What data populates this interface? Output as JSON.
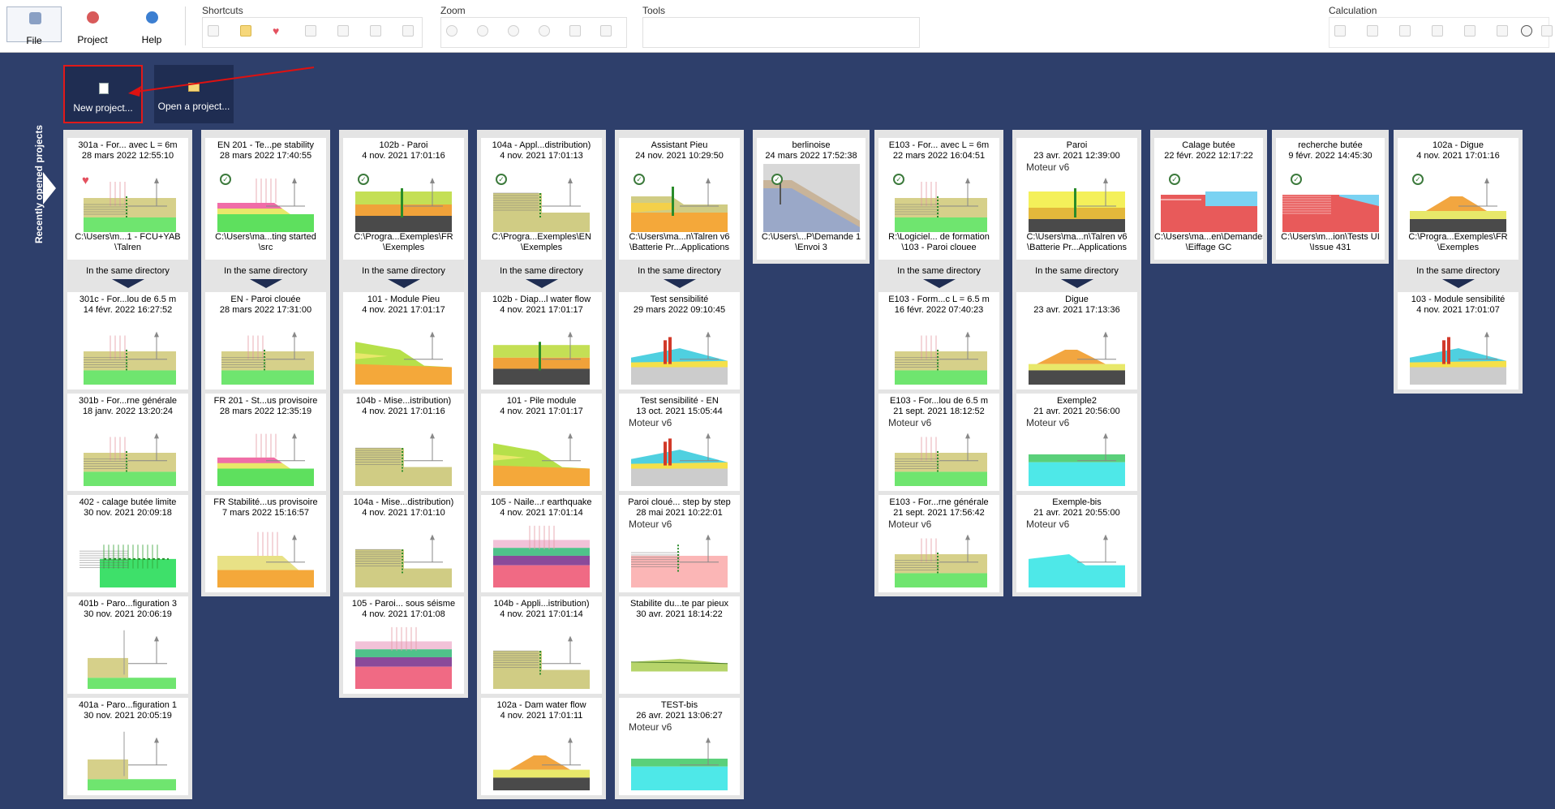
{
  "ribbon": {
    "file_label": "File",
    "project_label": "Project",
    "help_label": "Help",
    "groups": {
      "shortcuts": "Shortcuts",
      "zoom": "Zoom",
      "tools": "Tools",
      "calculation": "Calculation"
    }
  },
  "actions": {
    "new_project": "New project...",
    "open_project": "Open a project..."
  },
  "side_tab_label": "Recently opened projects",
  "same_dir_label": "In the same directory",
  "engine_tag": "Moteur v6",
  "columns": [
    {
      "top": {
        "title": "301a - For... avec L = 6m",
        "date": "28 mars 2022 12:55:10",
        "path1": "C:\\Users\\m...1 - FCU+YAB",
        "path2": "\\Talren",
        "badge": "heart",
        "scene": "nails-green"
      },
      "items": [
        {
          "title": "301c - For...lou de 6.5 m",
          "date": "14 févr. 2022 16:27:52",
          "scene": "nails-green"
        },
        {
          "title": "301b - For...rne générale",
          "date": "18 janv. 2022 13:20:24",
          "scene": "nails-green"
        },
        {
          "title": "402 - calage butée limite",
          "date": "30 nov. 2021 20:09:18",
          "scene": "wall-green"
        },
        {
          "title": "401b - Paro...figuration 3",
          "date": "30 nov. 2021 20:06:19",
          "scene": "step-green"
        },
        {
          "title": "401a - Paro...figuration 1",
          "date": "30 nov. 2021 20:05:19",
          "scene": "step-green"
        }
      ]
    },
    {
      "top": {
        "title": "EN 201 - Te...pe stability",
        "date": "28 mars 2022 17:40:55",
        "path1": "C:\\Users\\ma...ting started",
        "path2": "\\src",
        "badge": "check",
        "scene": "slope-yellow"
      },
      "items": [
        {
          "title": "EN - Paroi clouée",
          "date": "28 mars 2022 17:31:00",
          "scene": "nails-green"
        },
        {
          "title": "FR 201 - St...us provisoire",
          "date": "28 mars 2022 12:35:19",
          "scene": "slope-yellow"
        },
        {
          "title": "FR Stabilité...us provisoire",
          "date": "7 mars 2022 15:16:57",
          "scene": "slope-orange"
        }
      ]
    },
    {
      "top": {
        "title": "102b - Paroi",
        "date": "4 nov. 2021 17:01:16",
        "path1": "C:\\Progra...Exemples\\FR",
        "path2": "\\Exemples",
        "badge": "check",
        "scene": "paroi"
      },
      "items": [
        {
          "title": "101 - Module Pieu",
          "date": "4 nov. 2021 17:01:17",
          "scene": "slope-lime"
        },
        {
          "title": "104b - Mise...istribution)",
          "date": "4 nov. 2021 17:01:16",
          "scene": "wall-khaki"
        },
        {
          "title": "104a - Mise...distribution)",
          "date": "4 nov. 2021 17:01:10",
          "scene": "wall-khaki"
        },
        {
          "title": "105 - Paroi... sous séisme",
          "date": "4 nov. 2021 17:01:08",
          "scene": "seismic"
        }
      ]
    },
    {
      "top": {
        "title": "104a - Appl...distribution)",
        "date": "4 nov. 2021 17:01:13",
        "path1": "C:\\Progra...Exemples\\EN",
        "path2": "\\Exemples",
        "badge": "check",
        "scene": "wall-khaki"
      },
      "items": [
        {
          "title": "102b - Diap...l water flow",
          "date": "4 nov. 2021 17:01:17",
          "scene": "paroi"
        },
        {
          "title": "101 - Pile module",
          "date": "4 nov. 2021 17:01:17",
          "scene": "slope-lime"
        },
        {
          "title": "105 - Naile...r earthquake",
          "date": "4 nov. 2021 17:01:14",
          "scene": "seismic"
        },
        {
          "title": "104b - Appli...istribution)",
          "date": "4 nov. 2021 17:01:14",
          "scene": "wall-khaki"
        },
        {
          "title": "102a - Dam water flow",
          "date": "4 nov. 2021 17:01:11",
          "scene": "dam"
        }
      ]
    },
    {
      "top": {
        "title": "Assistant Pieu",
        "date": "24 nov. 2021 10:29:50",
        "path1": "C:\\Users\\ma...n\\Talren v6",
        "path2": "\\Batterie Pr...Applications",
        "badge": "check",
        "scene": "slope-orange-wall"
      },
      "items": [
        {
          "title": "Test sensibilité",
          "date": "29 mars 2022 09:10:45",
          "scene": "sensitivity"
        },
        {
          "title": "Test sensibilité - EN",
          "date": "13 oct. 2021 15:05:44",
          "scene": "sensitivity",
          "engine": true
        },
        {
          "title": "Paroi cloué... step by step",
          "date": "28 mai 2021 10:22:01",
          "scene": "pink",
          "engine": true
        },
        {
          "title": "Stabilite du...te par pieux",
          "date": "30 avr. 2021 18:14:22",
          "scene": "flat-green"
        },
        {
          "title": "TEST-bis",
          "date": "26 avr. 2021 13:06:27",
          "scene": "cyan",
          "engine": true
        }
      ]
    },
    {
      "top": {
        "title": "berlinoise",
        "date": "24 mars 2022 17:52:38",
        "path1": "C:\\Users\\...P\\Demande 1",
        "path2": "\\Envoi 3",
        "badge": "check",
        "scene": "grey-slope"
      },
      "items": []
    },
    {
      "top": {
        "title": "E103 - For... avec L = 6m",
        "date": "22 mars 2022 16:04:51",
        "path1": "R:\\Logiciel... de formation",
        "path2": "\\103 - Paroi clouee",
        "badge": "check",
        "scene": "nails-green"
      },
      "items": [
        {
          "title": "E103 - Form...c L = 6.5 m",
          "date": "16 févr. 2022 07:40:23",
          "scene": "nails-green"
        },
        {
          "title": "E103 - For...lou de 6.5 m",
          "date": "21 sept. 2021 18:12:52",
          "scene": "nails-green",
          "engine": true
        },
        {
          "title": "E103 - For...rne générale",
          "date": "21 sept. 2021 17:56:42",
          "scene": "nails-green",
          "engine": true
        }
      ]
    },
    {
      "top": {
        "title": "Paroi",
        "date": "23 avr. 2021 12:39:00",
        "path1": "C:\\Users\\ma...n\\Talren v6",
        "path2": "\\Batterie Pr...Applications",
        "badge": "none",
        "scene": "paroi-yellow",
        "engine": true
      },
      "items": [
        {
          "title": "Digue",
          "date": "23 avr. 2021 17:13:36",
          "scene": "dam-dark"
        },
        {
          "title": "Exemple2",
          "date": "21 avr. 2021 20:56:00",
          "scene": "cyan",
          "engine": true
        },
        {
          "title": "Exemple-bis",
          "date": "21 avr. 2021 20:55:00",
          "scene": "cyan-mound",
          "engine": true
        }
      ]
    },
    {
      "top": {
        "title": "Calage butée",
        "date": "22 févr. 2022 12:17:22",
        "path1": "C:\\Users\\ma...en\\Demandes",
        "path2": "\\Eiffage GC",
        "badge": "check",
        "scene": "red-cyan"
      },
      "items": []
    },
    {
      "top": {
        "title": "recherche butée",
        "date": "9 févr. 2022 14:45:30",
        "path1": "C:\\Users\\m...ion\\Tests UI",
        "path2": "\\Issue 431",
        "badge": "check",
        "scene": "red-lines"
      },
      "items": []
    },
    {
      "top": {
        "title": "102a - Digue",
        "date": "4 nov. 2021 17:01:16",
        "path1": "C:\\Progra...Exemples\\FR",
        "path2": "\\Exemples",
        "badge": "check",
        "scene": "dam"
      },
      "items": [
        {
          "title": "103 - Module sensibilité",
          "date": "4 nov. 2021 17:01:07",
          "scene": "sensitivity"
        }
      ]
    }
  ]
}
